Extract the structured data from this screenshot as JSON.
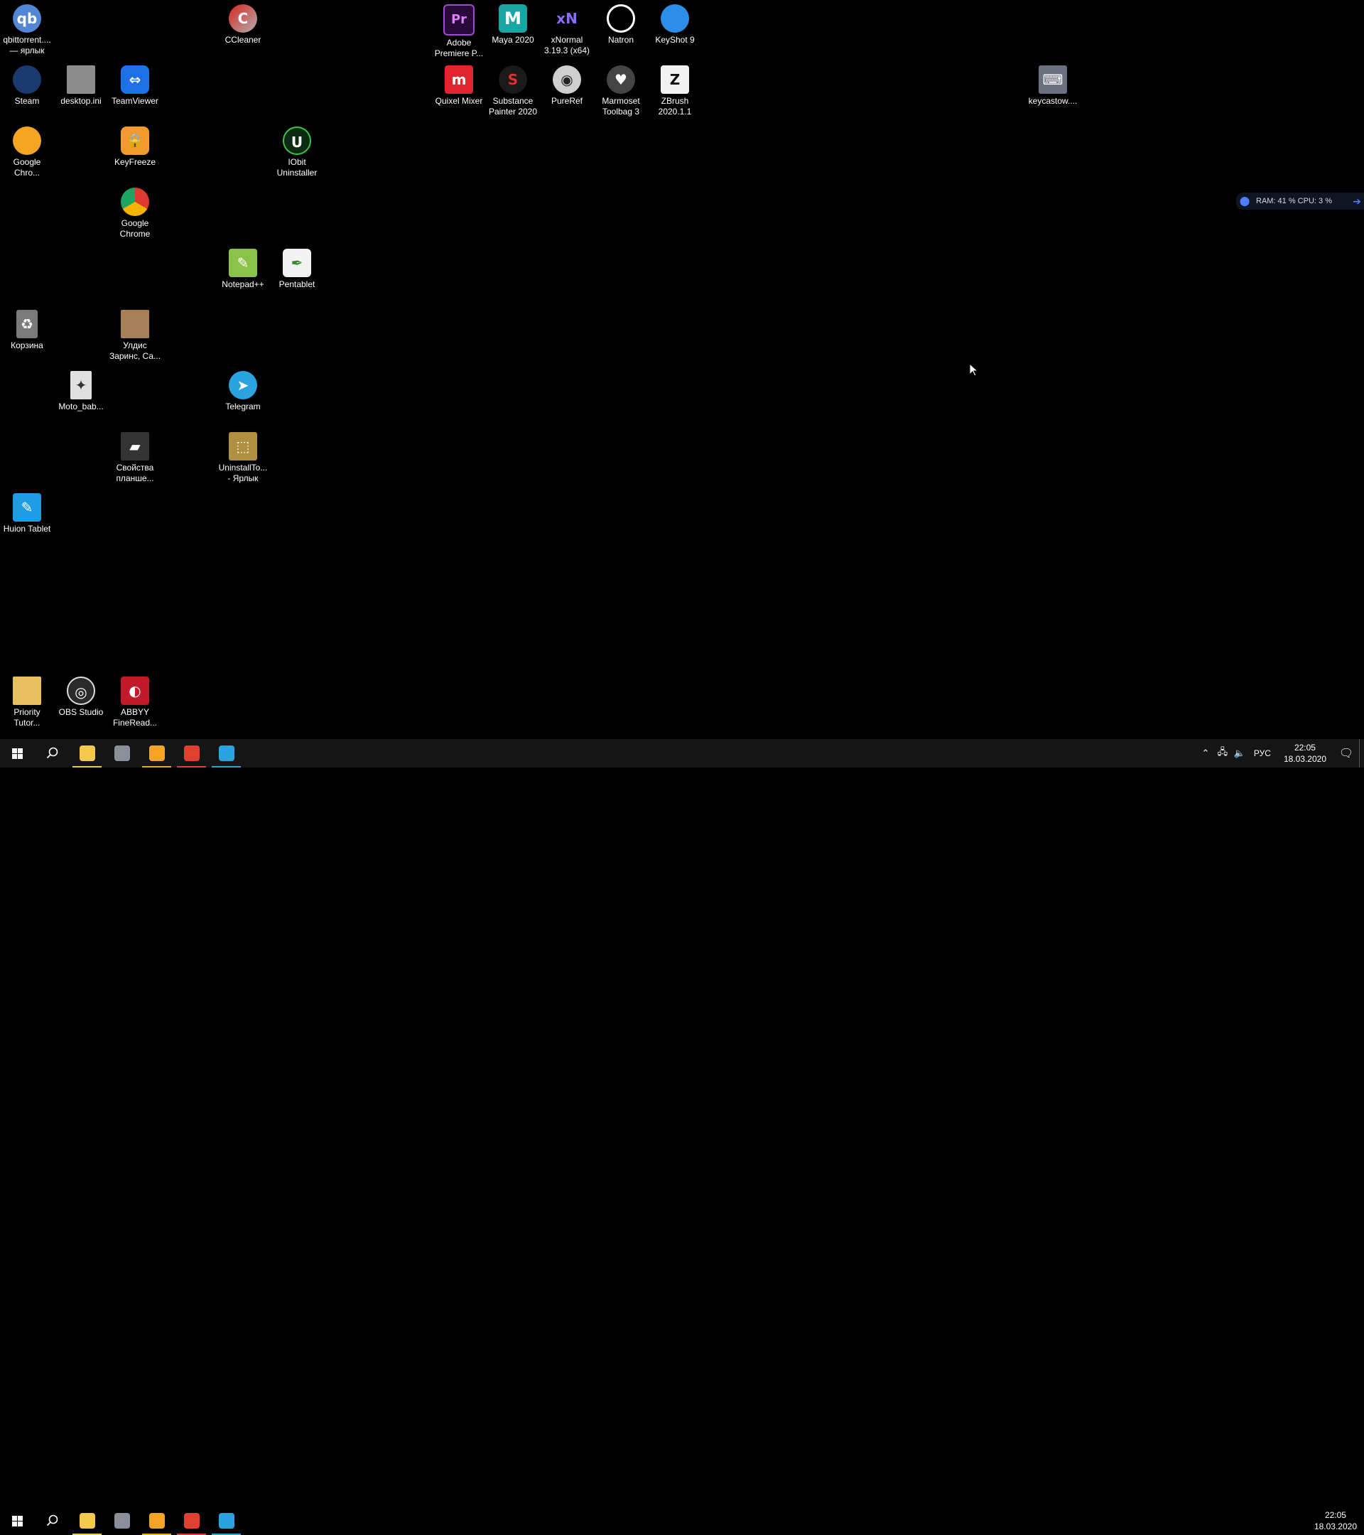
{
  "desktop": {
    "icons": [
      {
        "label": "qbittorrent....\n— ярлык",
        "icon": "qbittorrent-icon",
        "glyph": "qb",
        "cls": "c-qb",
        "col": 0,
        "row": 0
      },
      {
        "label": "CCleaner",
        "icon": "ccleaner-icon",
        "glyph": "C",
        "cls": "c-cc",
        "col": 4,
        "row": 0
      },
      {
        "label": "Adobe\nPremiere P...",
        "icon": "premiere-icon",
        "glyph": "Pr",
        "cls": "c-pr",
        "col": 8,
        "row": 0
      },
      {
        "label": "Maya 2020",
        "icon": "maya-icon",
        "glyph": "M",
        "cls": "c-maya",
        "col": 9,
        "row": 0
      },
      {
        "label": "xNormal\n3.19.3 (x64)",
        "icon": "xnormal-icon",
        "glyph": "xN",
        "cls": "c-xn",
        "col": 10,
        "row": 0
      },
      {
        "label": "Natron",
        "icon": "natron-icon",
        "glyph": "",
        "cls": "c-natron",
        "col": 11,
        "row": 0
      },
      {
        "label": "KeyShot 9",
        "icon": "keyshot-icon",
        "glyph": "",
        "cls": "c-key",
        "col": 12,
        "row": 0
      },
      {
        "label": "Steam",
        "icon": "steam-icon",
        "glyph": "",
        "cls": "c-steam",
        "col": 0,
        "row": 1
      },
      {
        "label": "desktop.ini",
        "icon": "settings-file-icon",
        "glyph": "",
        "cls": "c-ini",
        "col": 1,
        "row": 1
      },
      {
        "label": "TeamViewer",
        "icon": "teamviewer-icon",
        "glyph": "⇔",
        "cls": "c-tv",
        "col": 2,
        "row": 1
      },
      {
        "label": "Quixel Mixer",
        "icon": "quixel-mixer-icon",
        "glyph": "m",
        "cls": "c-quixel",
        "col": 8,
        "row": 1
      },
      {
        "label": "Substance\nPainter 2020",
        "icon": "substance-painter-icon",
        "glyph": "S",
        "cls": "c-sub",
        "col": 9,
        "row": 1
      },
      {
        "label": "PureRef",
        "icon": "pureref-icon",
        "glyph": "◉",
        "cls": "c-pure",
        "col": 10,
        "row": 1
      },
      {
        "label": "Marmoset\nToolbag 3",
        "icon": "marmoset-icon",
        "glyph": "♥",
        "cls": "c-marm",
        "col": 11,
        "row": 1
      },
      {
        "label": "ZBrush\n2020.1.1",
        "icon": "zbrush-icon",
        "glyph": "Z",
        "cls": "c-zb",
        "col": 12,
        "row": 1
      },
      {
        "label": "keycastow....",
        "icon": "keycastow-icon",
        "glyph": "⌨",
        "cls": "c-keycast",
        "col": 19,
        "row": 1
      },
      {
        "label": "Google\nChro...",
        "icon": "google-chrome-canary-icon",
        "glyph": "",
        "cls": "c-gchro",
        "col": 0,
        "row": 2
      },
      {
        "label": "KeyFreeze",
        "icon": "keyfreeze-icon",
        "glyph": "🔒",
        "cls": "c-kf",
        "col": 2,
        "row": 2
      },
      {
        "label": "IObit\nUninstaller",
        "icon": "iobit-uninstaller-icon",
        "glyph": "U",
        "cls": "c-iobit",
        "col": 5,
        "row": 2
      },
      {
        "label": "Google\nChrome",
        "icon": "google-chrome-icon",
        "glyph": "",
        "cls": "c-chrome",
        "col": 2,
        "row": 3
      },
      {
        "label": "Notepad++",
        "icon": "notepad-plus-plus-icon",
        "glyph": "✎",
        "cls": "c-npp",
        "col": 4,
        "row": 4
      },
      {
        "label": "Pentablet",
        "icon": "pentablet-icon",
        "glyph": "✒",
        "cls": "c-pent",
        "col": 5,
        "row": 4
      },
      {
        "label": "Корзина",
        "icon": "recycle-bin-icon",
        "glyph": "♻",
        "cls": "c-bin",
        "col": 0,
        "row": 5
      },
      {
        "label": "Улдис\nЗаринс, Са...",
        "icon": "image-file-icon",
        "glyph": "",
        "cls": "c-uldis",
        "col": 2,
        "row": 5
      },
      {
        "label": "Moto_bab...",
        "icon": "image-file-icon",
        "glyph": "✦",
        "cls": "c-moto",
        "col": 1,
        "row": 6
      },
      {
        "label": "Telegram",
        "icon": "telegram-icon",
        "glyph": "➤",
        "cls": "c-tg",
        "col": 4,
        "row": 6
      },
      {
        "label": "Свойства\nпланше...",
        "icon": "tablet-properties-icon",
        "glyph": "▰",
        "cls": "c-props",
        "col": 2,
        "row": 7
      },
      {
        "label": "UninstallTo...\n- Ярлык",
        "icon": "uninstall-tool-icon",
        "glyph": "⬚",
        "cls": "c-unins",
        "col": 4,
        "row": 7
      },
      {
        "label": "Huion Tablet",
        "icon": "huion-tablet-icon",
        "glyph": "✎",
        "cls": "c-huion",
        "col": 0,
        "row": 8
      },
      {
        "label": "Priority\nTutor...",
        "icon": "folder-icon",
        "glyph": "",
        "cls": "c-prio",
        "col": 0,
        "row": 11
      },
      {
        "label": "OBS Studio",
        "icon": "obs-studio-icon",
        "glyph": "◎",
        "cls": "c-obs",
        "col": 1,
        "row": 11
      },
      {
        "label": "ABBYY\nFineRead...",
        "icon": "abbyy-finereader-icon",
        "glyph": "◐",
        "cls": "c-abbyy",
        "col": 2,
        "row": 11
      }
    ]
  },
  "sysmon": {
    "text": "RAM: 41 % CPU: 3 %"
  },
  "taskbar": {
    "apps": [
      {
        "name": "start-button",
        "kind": "start"
      },
      {
        "name": "search-button",
        "kind": "search"
      },
      {
        "name": "file-explorer-taskbar",
        "kind": "explorer",
        "color": "#f2c94c",
        "open": true
      },
      {
        "name": "tablet-settings-taskbar",
        "kind": "app",
        "color": "#8a8f99",
        "open": false
      },
      {
        "name": "chrome-canary-taskbar",
        "kind": "app",
        "color": "#f4a523",
        "open": true
      },
      {
        "name": "screen-recorder-taskbar",
        "kind": "app",
        "color": "#e0402f",
        "open": true
      },
      {
        "name": "telegram-taskbar",
        "kind": "app",
        "color": "#2aa3df",
        "open": true
      }
    ],
    "lang": "РУС",
    "time": "22:05",
    "date": "18.03.2020",
    "notifications": "1"
  },
  "colors": {
    "desktop_bg": "#000000",
    "taskbar_bg": "#151515",
    "accent": "#9ab8e0"
  }
}
